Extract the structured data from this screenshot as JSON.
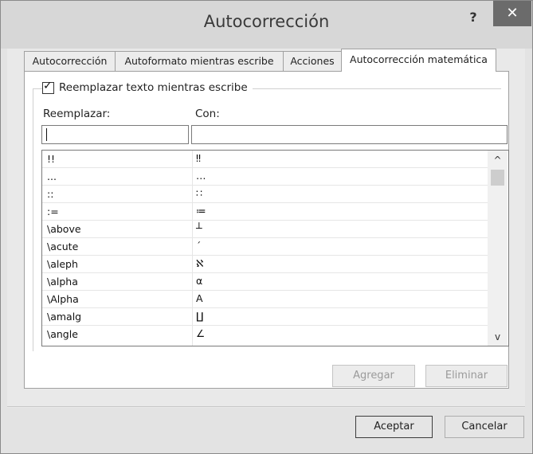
{
  "window": {
    "title": "Autocorrección",
    "help": "?",
    "close": "✕"
  },
  "tabs": [
    {
      "label": "Autocorrección"
    },
    {
      "label": "Autoformato mientras escribe"
    },
    {
      "label": "Acciones"
    },
    {
      "label": "Autocorrección matemática"
    }
  ],
  "options": {
    "replace_checkbox": "Reemplazar texto mientras escribe",
    "replace_label": "Reemplazar:",
    "with_label": "Con:",
    "replace_value": "",
    "with_value": ""
  },
  "list": [
    {
      "a": "!!",
      "b": "‼"
    },
    {
      "a": "...",
      "b": "…"
    },
    {
      "a": "::",
      "b": "∷"
    },
    {
      "a": ":=",
      "b": "≔"
    },
    {
      "a": "\\above",
      "b": "┴"
    },
    {
      "a": "\\acute",
      "b": "´"
    },
    {
      "a": "\\aleph",
      "b": "ℵ"
    },
    {
      "a": "\\alpha",
      "b": "α"
    },
    {
      "a": "\\Alpha",
      "b": "A"
    },
    {
      "a": "\\amalg",
      "b": "∐"
    },
    {
      "a": "\\angle",
      "b": "∠"
    }
  ],
  "scroll": {
    "up": "^",
    "down": "v"
  },
  "buttons": {
    "add": "Agregar",
    "delete": "Eliminar",
    "ok": "Aceptar",
    "cancel": "Cancelar"
  }
}
